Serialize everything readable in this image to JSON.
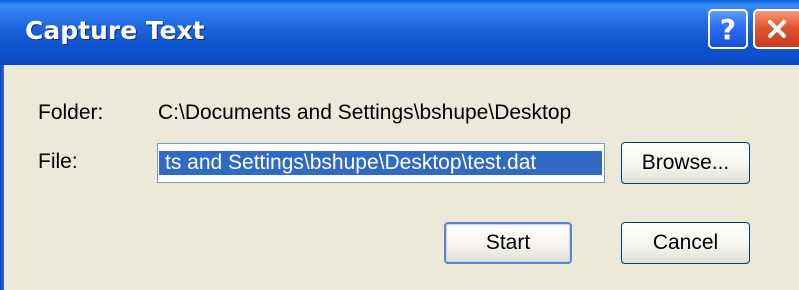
{
  "window": {
    "title": "Capture Text"
  },
  "titlebar": {
    "help_label": "?",
    "help_icon": "question-mark-icon",
    "close_icon": "close-x-icon"
  },
  "form": {
    "folder_label": "Folder:",
    "folder_value": "C:\\Documents and Settings\\bshupe\\Desktop",
    "file_label": "File:",
    "file_value_visible": "ts and Settings\\bshupe\\Desktop\\test.dat"
  },
  "buttons": {
    "browse": "Browse...",
    "start": "Start",
    "cancel": "Cancel"
  },
  "colors": {
    "titlebar_blue": "#1d63d9",
    "close_red": "#e2572f",
    "dialog_face": "#ece9d8",
    "selection_highlight": "#316ac5"
  }
}
